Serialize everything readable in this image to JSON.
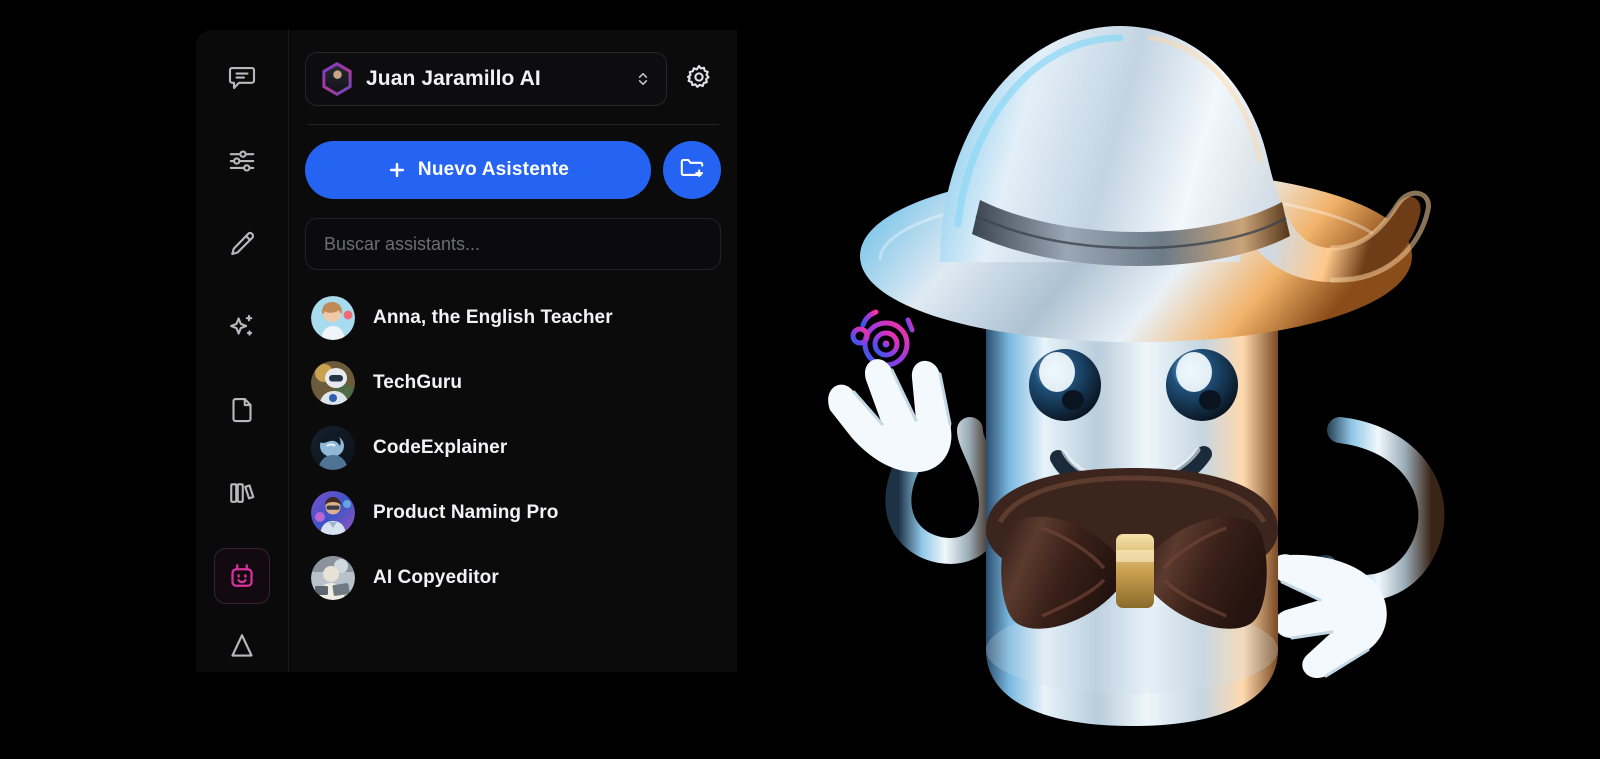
{
  "app": {
    "panel_background": "#0b0b0c",
    "accent_blue": "#2563f2",
    "accent_pink": "#d9329c"
  },
  "rail": {
    "items": [
      {
        "name": "chat-icon",
        "label": "Chats",
        "active": false
      },
      {
        "name": "sliders-icon",
        "label": "Ajustes",
        "active": false
      },
      {
        "name": "pencil-icon",
        "label": "Escribir",
        "active": false
      },
      {
        "name": "sparkles-icon",
        "label": "Magia",
        "active": false
      },
      {
        "name": "document-icon",
        "label": "Documentos",
        "active": false
      },
      {
        "name": "books-icon",
        "label": "Biblioteca",
        "active": false
      },
      {
        "name": "bot-icon",
        "label": "Asistentes",
        "active": true
      }
    ]
  },
  "profile": {
    "name": "Juan Jaramillo AI",
    "avatar_icon": "user-avatar-hex",
    "chevron_icon": "chevron-up-down-icon",
    "settings_icon": "gear-icon"
  },
  "actions": {
    "new_assistant_label": "Nuevo Asistente",
    "new_assistant_icon": "plus-icon",
    "new_folder_icon": "folder-plus-icon"
  },
  "search": {
    "placeholder": "Buscar assistants...",
    "value": ""
  },
  "assistants": {
    "items": [
      {
        "name": "Anna, the English Teacher",
        "avatar": "anna-avatar"
      },
      {
        "name": "TechGuru",
        "avatar": "techguru-avatar"
      },
      {
        "name": "CodeExplainer",
        "avatar": "codeexplainer-avatar"
      },
      {
        "name": "Product Naming Pro",
        "avatar": "productnaming-avatar"
      },
      {
        "name": "AI Copyeditor",
        "avatar": "copyeditor-avatar"
      }
    ]
  },
  "artwork": {
    "mascot_alt": "Chrome wizard robot mascot with pointed hat and bow tie",
    "brandmark_alt": "Pink to blue gradient gear logo"
  }
}
